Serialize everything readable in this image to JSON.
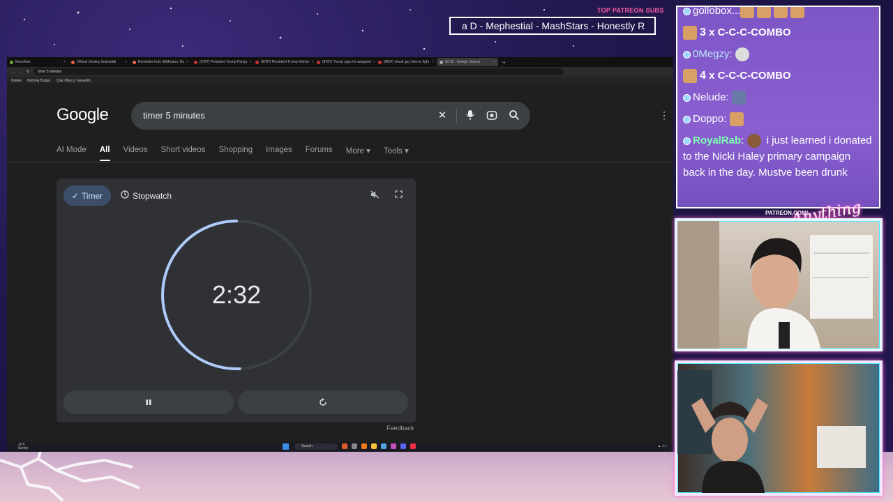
{
  "overlay": {
    "patreon_label": "TOP PATREON SUBS",
    "ticker_text": "a D - Mephestial - MashStars - Honestly R",
    "patreon_url": "PATREON.COM/",
    "logo_text": "Anything Else"
  },
  "browser": {
    "tabs": [
      {
        "label": "More/less"
      },
      {
        "label": "Official Destiny Subreddit"
      },
      {
        "label": "Reminder from MrMouton, No"
      },
      {
        "label": "(8787) President Trump Partyp"
      },
      {
        "label": "(8787) President Trump Deliver"
      },
      {
        "label": "(8787) Trump says he swapped"
      },
      {
        "label": "(8697) drunk guy tries to fight"
      },
      {
        "label": "02:32 - Google Search",
        "active": true
      }
    ],
    "address": "timer 5 minutes",
    "bookmarks": [
      "Dailies",
      "Nothing Burger",
      "Clair Obscur: Expediti..."
    ]
  },
  "google": {
    "logo": "Google",
    "query": "timer 5 minutes",
    "nav": [
      {
        "label": "AI Mode"
      },
      {
        "label": "All",
        "active": true
      },
      {
        "label": "Videos"
      },
      {
        "label": "Short videos"
      },
      {
        "label": "Shopping"
      },
      {
        "label": "Images"
      },
      {
        "label": "Forums"
      },
      {
        "label": "More ▾"
      },
      {
        "label": "Tools ▾"
      }
    ],
    "timer": {
      "tab_timer": "Timer",
      "tab_stopwatch": "Stopwatch",
      "display": "2:32",
      "remaining_fraction": 0.507
    },
    "feedback": "Feedback"
  },
  "taskbar": {
    "weather_temp": "-9°C",
    "weather_desc": "Sunny",
    "search_placeholder": "Search"
  },
  "chat": {
    "messages": [
      {
        "user": "gollobox...",
        "text": ""
      },
      {
        "count": "3",
        "text": "C-C-C-COMBO"
      },
      {
        "user": "0Megzy",
        "text": ""
      },
      {
        "count": "4",
        "text": "C-C-C-COMBO"
      },
      {
        "user": "Nelude",
        "text": ""
      },
      {
        "user": "Doppo",
        "text": ""
      },
      {
        "user": "RoyalRab",
        "text": "i just learned i donated to the Nicki Haley primary campaign back in the day. Mustve been drunk"
      }
    ]
  }
}
